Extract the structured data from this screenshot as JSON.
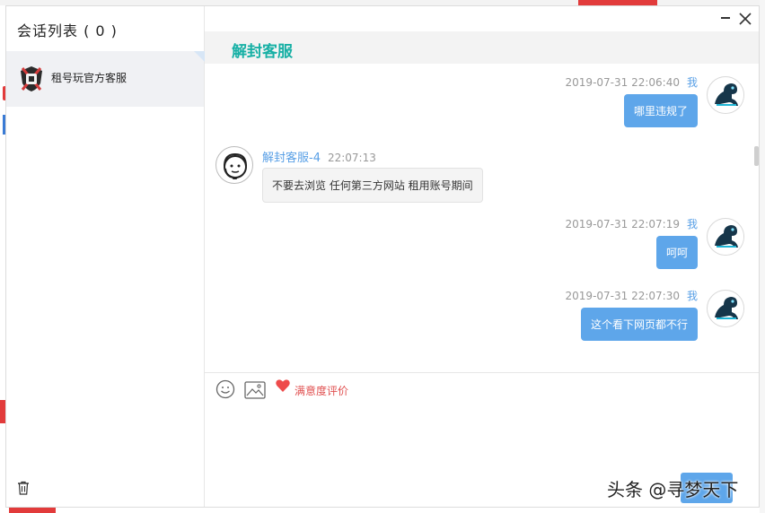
{
  "sidebar": {
    "title": "会话列表 ( 0 )",
    "sessions": [
      {
        "name": "租号玩官方客服"
      }
    ]
  },
  "chat": {
    "title": "解封客服",
    "messages": [
      {
        "from": "me",
        "time": "2019-07-31 22:06:40",
        "who": "我",
        "text": "哪里违规了"
      },
      {
        "from": "agent",
        "time": "22:07:13",
        "who": "解封客服-4",
        "text": "不要去浏览 任何第三方网站 租用账号期间"
      },
      {
        "from": "me",
        "time": "2019-07-31 22:07:19",
        "who": "我",
        "text": "呵呵"
      },
      {
        "from": "me",
        "time": "2019-07-31 22:07:30",
        "who": "我",
        "text": "这个看下网页都不行"
      }
    ]
  },
  "toolbar": {
    "rating_label": "满意度评价"
  },
  "watermark": "头条 @寻梦天下",
  "colors": {
    "accent": "#17b0a5",
    "bubble_me": "#5ea6ea",
    "rating": "#e05050"
  }
}
